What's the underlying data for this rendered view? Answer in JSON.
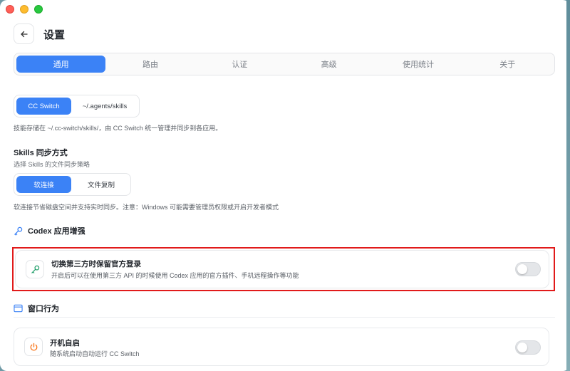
{
  "window": {
    "colors": {
      "accent": "#3b82f6",
      "highlight": "#e11a1a"
    }
  },
  "header": {
    "title": "设置",
    "back_icon": "arrow-left-icon"
  },
  "tabs": [
    {
      "label": "通用",
      "active": true
    },
    {
      "label": "路由",
      "active": false
    },
    {
      "label": "认证",
      "active": false
    },
    {
      "label": "高级",
      "active": false
    },
    {
      "label": "使用统计",
      "active": false
    },
    {
      "label": "关于",
      "active": false
    }
  ],
  "skills_location": {
    "options": [
      {
        "label": "CC Switch",
        "active": true
      },
      {
        "label": "~/.agents/skills",
        "active": false
      }
    ],
    "hint": "技能存储在 ~/.cc-switch/skills/，由 CC Switch 统一管理并同步到各应用。"
  },
  "skills_sync": {
    "title": "Skills 同步方式",
    "subtitle": "选择 Skills 的文件同步策略",
    "options": [
      {
        "label": "软连接",
        "active": true
      },
      {
        "label": "文件复制",
        "active": false
      }
    ],
    "hint": "软连接节省磁盘空间并支持实时同步。注意：Windows 可能需要管理员权限或开启开发者模式"
  },
  "codex_section": {
    "heading": "Codex 应用增强",
    "icon": "key-icon",
    "card": {
      "title": "切换第三方时保留官方登录",
      "description": "开启后可以在使用第三方 API 的时候使用 Codex 应用的官方插件、手机远程操作等功能",
      "enabled": false
    }
  },
  "window_section": {
    "heading": "窗口行为",
    "icon": "window-icon",
    "card": {
      "title": "开机自启",
      "description": "随系统启动自动运行 CC Switch",
      "icon": "power-icon",
      "enabled": false
    }
  }
}
